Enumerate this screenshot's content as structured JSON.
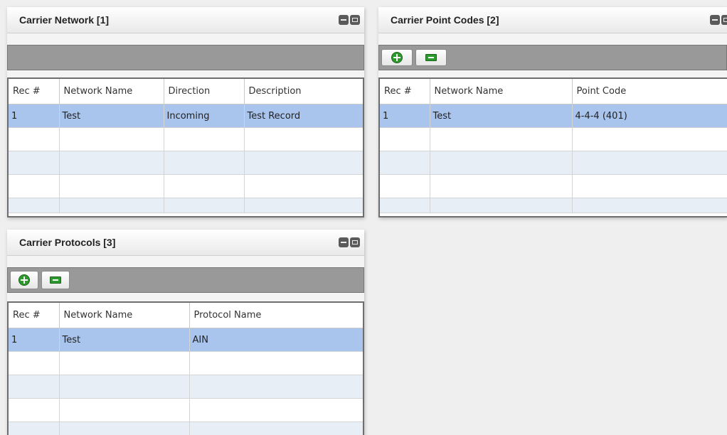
{
  "carrier_network": {
    "title": "Carrier Network [1]",
    "columns": [
      "Rec #",
      "Network Name",
      "Direction",
      "Description"
    ],
    "rows": [
      [
        "1",
        "Test",
        "Incoming",
        "Test Record"
      ]
    ]
  },
  "carrier_point_codes": {
    "title": "Carrier Point Codes [2]",
    "columns": [
      "Rec #",
      "Network Name",
      "Point Code"
    ],
    "rows": [
      [
        "1",
        "Test",
        "4-4-4 (401)"
      ]
    ]
  },
  "carrier_protocols": {
    "title": "Carrier Protocols [3]",
    "columns": [
      "Rec #",
      "Network Name",
      "Protocol Name"
    ],
    "rows": [
      [
        "1",
        "Test",
        "AIN"
      ]
    ]
  },
  "icons": {
    "add": "add-icon",
    "remove": "remove-icon",
    "minimize": "minimize-icon",
    "maximize": "maximize-icon"
  },
  "colors": {
    "selected_row": "#a9c4ed",
    "alt_row": "#e8eef6",
    "toolbar": "#999999",
    "icon_green": "#2d9a2d"
  }
}
